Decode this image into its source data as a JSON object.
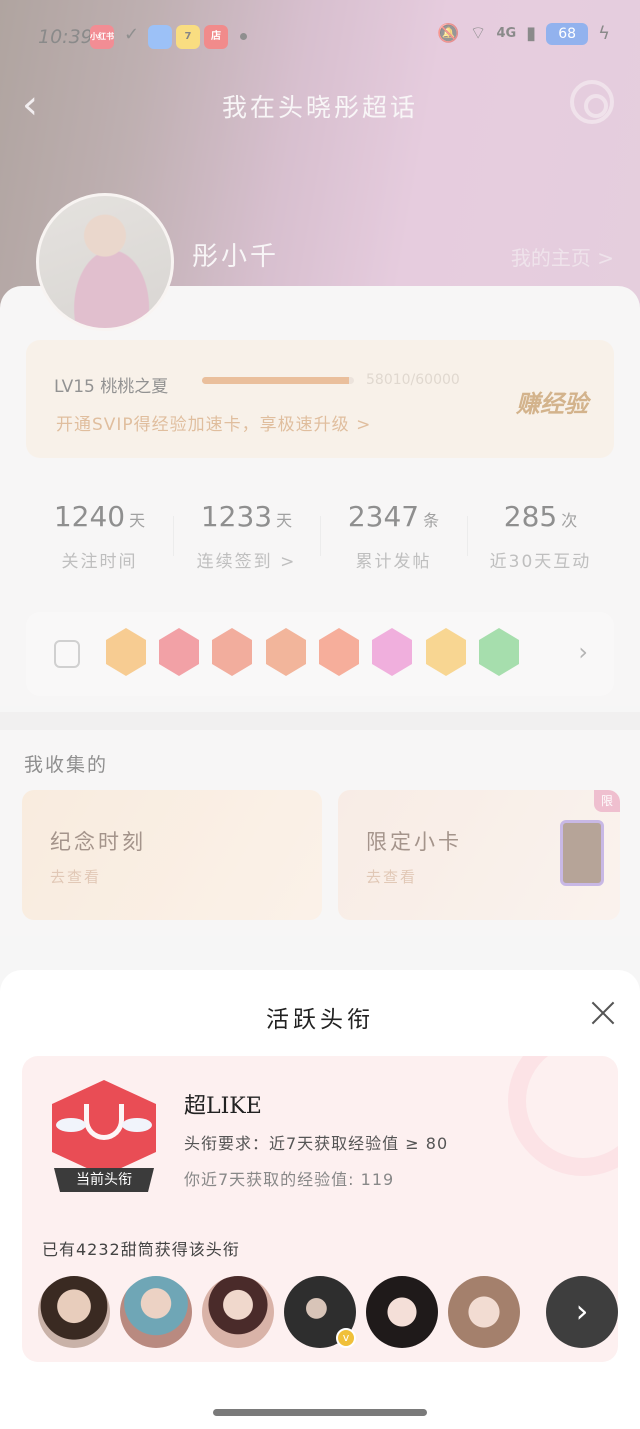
{
  "status_bar": {
    "time": "10:39",
    "apps": [
      {
        "label": "小红书",
        "color": "#e8303c"
      },
      {
        "label": "✓",
        "color": "transparent"
      },
      {
        "label": "",
        "color": "#4b8ff0"
      },
      {
        "label": "7",
        "color": "#f4c21a"
      },
      {
        "label": "店",
        "color": "#e52c2c"
      }
    ],
    "network": "4G",
    "battery": "68"
  },
  "header": {
    "title": "我在头晓彤超话",
    "back_icon": "chevron-left-icon",
    "settings_icon": "gear-icon"
  },
  "profile": {
    "username": "彤小千",
    "my_page": "我的主页 >"
  },
  "level": {
    "text": "LV15 桃桃之夏",
    "progress": "58010/60000",
    "progress_fraction": 0.967,
    "promo": "开通SVIP得经验加速卡，享极速升级 >",
    "earn_label": "赚经验"
  },
  "stats": [
    {
      "value": "1240",
      "unit": "天",
      "label": "关注时间"
    },
    {
      "value": "1233",
      "unit": "天",
      "label": "连续签到 >"
    },
    {
      "value": "2347",
      "unit": "条",
      "label": "累计发帖"
    },
    {
      "value": "285",
      "unit": "次",
      "label": "近30天互动"
    }
  ],
  "badges": [
    {
      "color": "#f0a23a"
    },
    {
      "color": "#e8555d"
    },
    {
      "color": "#e86a4e"
    },
    {
      "color": "#e8784a"
    },
    {
      "color": "#ef6c4a"
    },
    {
      "color": "#e46ec1"
    },
    {
      "color": "#f2b43a"
    },
    {
      "color": "#5ec46a"
    }
  ],
  "collection": {
    "title": "我收集的",
    "cards": [
      {
        "title": "纪念时刻",
        "subtitle": "去查看"
      },
      {
        "title": "限定小卡",
        "subtitle": "去查看",
        "tag": "限"
      }
    ]
  },
  "sheet": {
    "title": "活跃头衔",
    "current_tag": "当前头衔",
    "title_name": "超LIKE",
    "requirement": "头衔要求：近7天获取经验值 ≥ 80",
    "my_value": "你近7天获取的经验值: 119",
    "count_text": "已有4232甜筒获得该头衔",
    "more_icon": "chevron-right-icon"
  },
  "colors": {
    "accent_orange": "#d98a4c",
    "sheet_card_bg": "#fdf0f0",
    "trophy_red": "#e94d55"
  }
}
